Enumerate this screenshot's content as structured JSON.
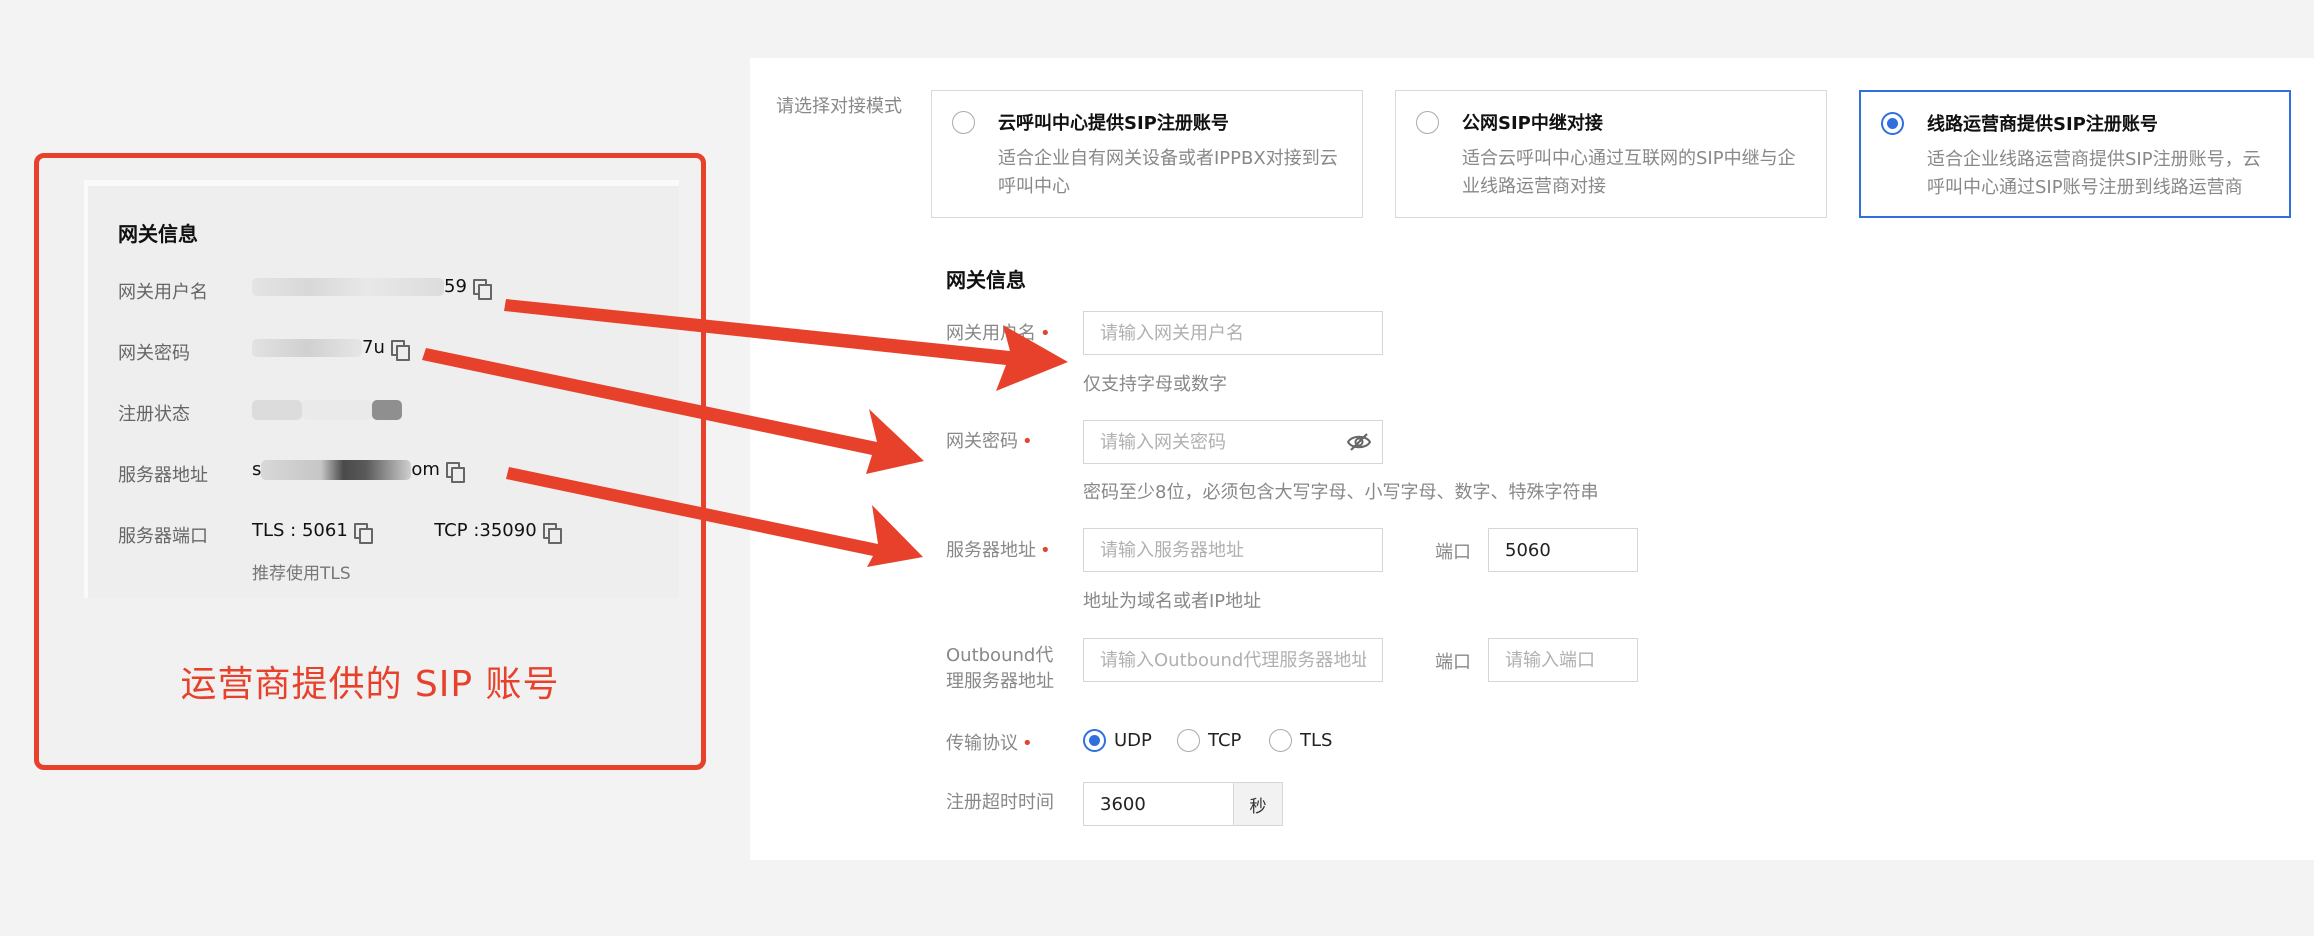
{
  "source_panel": {
    "card_title": "网关信息",
    "rows": [
      {
        "label": "网关用户名",
        "value_tail": "59"
      },
      {
        "label": "网关密码",
        "value_tail": "7u"
      },
      {
        "label": "注册状态"
      },
      {
        "label": "服务器地址",
        "value_head": "s",
        "value_tail": "om"
      },
      {
        "label": "服务器端口",
        "tls": "TLS : 5061",
        "tcp": "TCP :35090",
        "hint": "推荐使用TLS"
      }
    ],
    "caption": "运营商提供的 SIP 账号"
  },
  "form": {
    "mode_label": "请选择对接模式",
    "modes": [
      {
        "title": "云呼叫中心提供SIP注册账号",
        "desc": "适合企业自有网关设备或者IPPBX对接到云呼叫中心",
        "selected": false
      },
      {
        "title": "公网SIP中继对接",
        "desc": "适合云呼叫中心通过互联网的SIP中继与企业线路运营商对接",
        "selected": false
      },
      {
        "title": "线路运营商提供SIP注册账号",
        "desc": "适合企业线路运营商提供SIP注册账号，云呼叫中心通过SIP账号注册到线路运营商",
        "selected": true
      }
    ],
    "section_title": "网关信息",
    "username": {
      "label": "网关用户名",
      "placeholder": "请输入网关用户名",
      "hint": "仅支持字母或数字"
    },
    "password": {
      "label": "网关密码",
      "placeholder": "请输入网关密码",
      "hint": "密码至少8位，必须包含大写字母、小写字母、数字、特殊字符串"
    },
    "server": {
      "label": "服务器地址",
      "placeholder": "请输入服务器地址",
      "hint": "地址为域名或者IP地址",
      "port_label": "端口",
      "port_value": "5060"
    },
    "outbound": {
      "label_line1": "Outbound代",
      "label_line2": "理服务器地址",
      "placeholder": "请输入Outbound代理服务器地址",
      "port_label": "端口",
      "port_placeholder": "请输入端口"
    },
    "protocol": {
      "label": "传输协议",
      "options": [
        "UDP",
        "TCP",
        "TLS"
      ],
      "selected": "UDP"
    },
    "timeout": {
      "label": "注册超时时间",
      "value": "3600",
      "unit": "秒"
    }
  },
  "colors": {
    "accent": "#2f6fde",
    "annotation": "#e8412b",
    "required": "#e0462f"
  }
}
